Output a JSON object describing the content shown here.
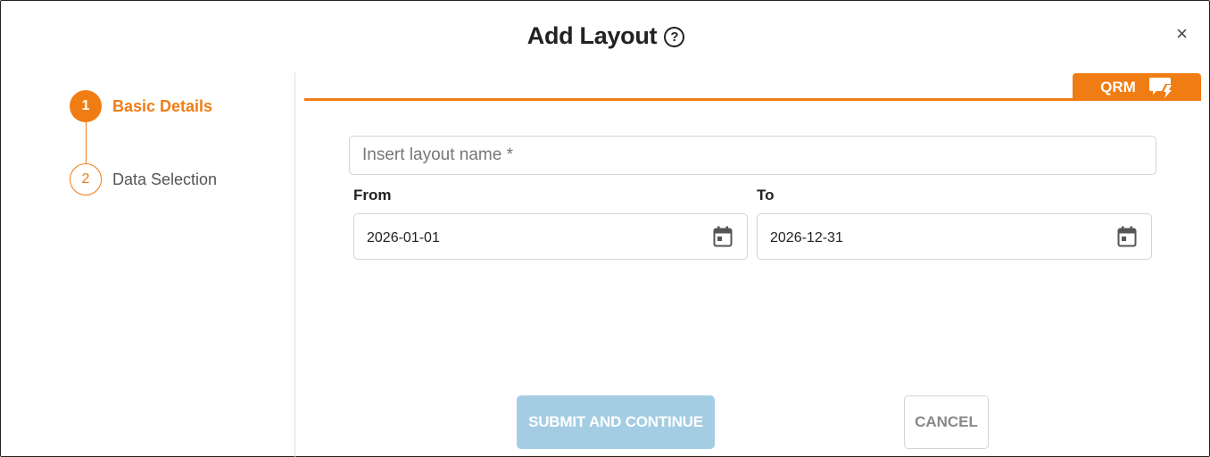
{
  "dialog": {
    "title": "Add Layout",
    "help_icon": "?",
    "close_icon": "×"
  },
  "steps": [
    {
      "number": "1",
      "label": "Basic Details",
      "state": "active"
    },
    {
      "number": "2",
      "label": "Data Selection",
      "state": "inactive"
    }
  ],
  "qrm": {
    "label": "QRM",
    "icon": "flash-chat-icon"
  },
  "form": {
    "name_placeholder": "Insert layout name *",
    "name_value": "",
    "from_label": "From",
    "from_value": "2026-01-01",
    "to_label": "To",
    "to_value": "2026-12-31"
  },
  "actions": {
    "submit_label": "SUBMIT AND CONTINUE",
    "cancel_label": "CANCEL"
  },
  "colors": {
    "accent": "#f07d13",
    "submit_disabled": "#a4cde3"
  }
}
